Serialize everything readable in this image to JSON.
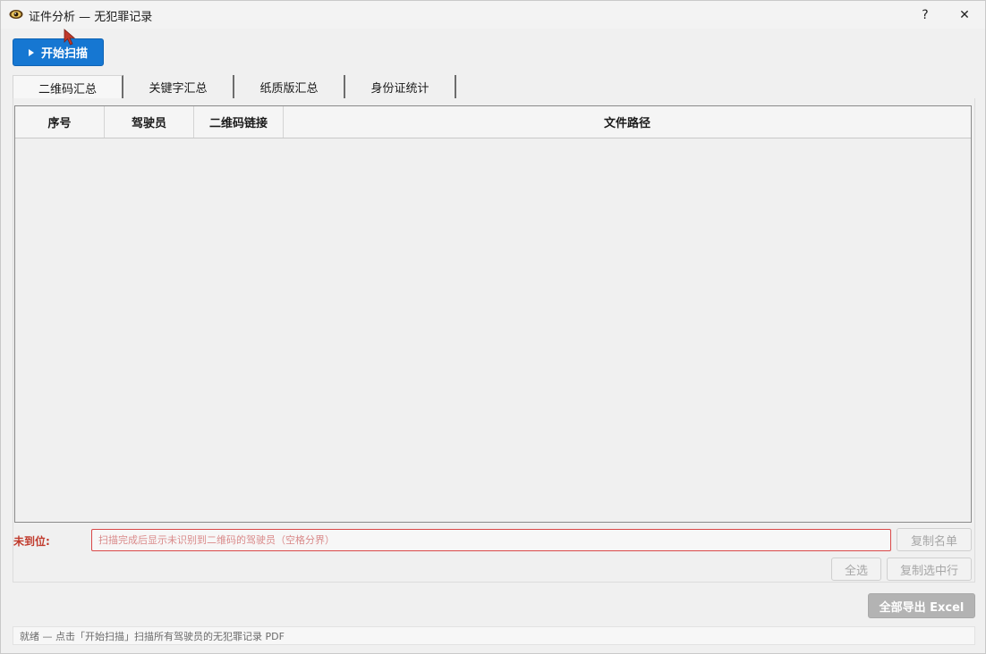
{
  "window": {
    "title": "证件分析 — 无犯罪记录",
    "help_label": "?",
    "close_label": "✕"
  },
  "toolbar": {
    "scan_label": "开始扫描"
  },
  "tabs": [
    {
      "label": "二维码汇总",
      "active": true
    },
    {
      "label": "关键字汇总",
      "active": false
    },
    {
      "label": "纸质版汇总",
      "active": false
    },
    {
      "label": "身份证统计",
      "active": false
    }
  ],
  "table": {
    "columns": [
      "序号",
      "驾驶员",
      "二维码链接",
      "文件路径"
    ],
    "rows": []
  },
  "missing": {
    "label": "未到位:",
    "placeholder": "扫描完成后显示未识别到二维码的驾驶员（空格分界）",
    "value": ""
  },
  "actions": {
    "copy_list_label": "复制名单",
    "select_all_label": "全选",
    "copy_selected_label": "复制选中行",
    "export_label": "全部导出 Excel"
  },
  "status": {
    "text": "就绪 — 点击「开始扫描」扫描所有驾驶员的无犯罪记录 PDF"
  },
  "colors": {
    "accent": "#1677d2",
    "warning": "#c0392b",
    "disabled": "#b3b3b3"
  },
  "icons": {
    "app": "eye-icon",
    "play": "play-icon",
    "cursor": "mouse-cursor-icon"
  }
}
